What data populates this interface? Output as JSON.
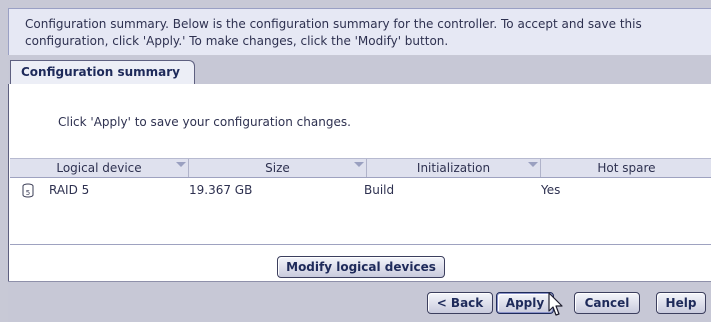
{
  "header": {
    "text": "Configuration summary. Below is the configuration summary for the controller.  To accept and save this configuration, click 'Apply.' To make changes, click the 'Modify' button."
  },
  "tabs": [
    {
      "label": "Configuration summary"
    }
  ],
  "main": {
    "instruction": "Click 'Apply' to save your configuration changes.",
    "table": {
      "columns": [
        "Logical device",
        "Size",
        "Initialization",
        "Hot spare"
      ],
      "rows": [
        {
          "icon": "disk-raid5-icon",
          "icon_label": "5",
          "logical_device": "RAID 5",
          "size": "19.367 GB",
          "initialization": "Build",
          "hot_spare": "Yes"
        }
      ]
    },
    "modify_button": "Modify logical devices"
  },
  "footer": {
    "back_button": "< Back",
    "apply_button": "Apply",
    "cancel_button": "Cancel",
    "help_button": "Help"
  },
  "colors": {
    "background": "#c8c9d6",
    "header_bg": "#e6e8f4",
    "panel_bg": "#ffffff",
    "button_text": "#1e2a5a"
  }
}
